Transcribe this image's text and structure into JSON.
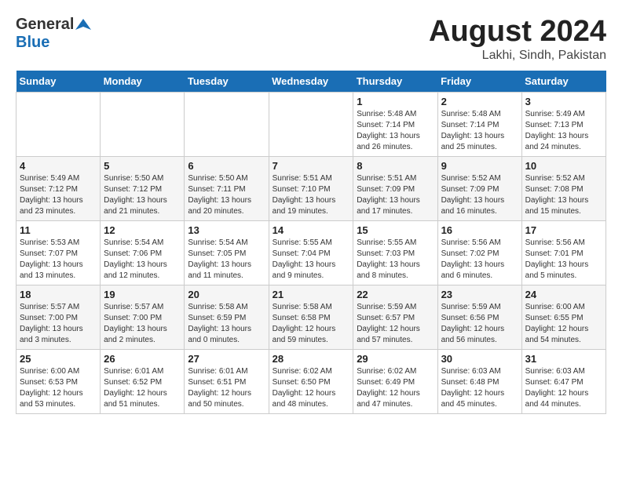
{
  "header": {
    "logo_general": "General",
    "logo_blue": "Blue",
    "title": "August 2024",
    "subtitle": "Lakhi, Sindh, Pakistan"
  },
  "weekdays": [
    "Sunday",
    "Monday",
    "Tuesday",
    "Wednesday",
    "Thursday",
    "Friday",
    "Saturday"
  ],
  "weeks": [
    [
      {
        "day": "",
        "info": ""
      },
      {
        "day": "",
        "info": ""
      },
      {
        "day": "",
        "info": ""
      },
      {
        "day": "",
        "info": ""
      },
      {
        "day": "1",
        "info": "Sunrise: 5:48 AM\nSunset: 7:14 PM\nDaylight: 13 hours\nand 26 minutes."
      },
      {
        "day": "2",
        "info": "Sunrise: 5:48 AM\nSunset: 7:14 PM\nDaylight: 13 hours\nand 25 minutes."
      },
      {
        "day": "3",
        "info": "Sunrise: 5:49 AM\nSunset: 7:13 PM\nDaylight: 13 hours\nand 24 minutes."
      }
    ],
    [
      {
        "day": "4",
        "info": "Sunrise: 5:49 AM\nSunset: 7:12 PM\nDaylight: 13 hours\nand 23 minutes."
      },
      {
        "day": "5",
        "info": "Sunrise: 5:50 AM\nSunset: 7:12 PM\nDaylight: 13 hours\nand 21 minutes."
      },
      {
        "day": "6",
        "info": "Sunrise: 5:50 AM\nSunset: 7:11 PM\nDaylight: 13 hours\nand 20 minutes."
      },
      {
        "day": "7",
        "info": "Sunrise: 5:51 AM\nSunset: 7:10 PM\nDaylight: 13 hours\nand 19 minutes."
      },
      {
        "day": "8",
        "info": "Sunrise: 5:51 AM\nSunset: 7:09 PM\nDaylight: 13 hours\nand 17 minutes."
      },
      {
        "day": "9",
        "info": "Sunrise: 5:52 AM\nSunset: 7:09 PM\nDaylight: 13 hours\nand 16 minutes."
      },
      {
        "day": "10",
        "info": "Sunrise: 5:52 AM\nSunset: 7:08 PM\nDaylight: 13 hours\nand 15 minutes."
      }
    ],
    [
      {
        "day": "11",
        "info": "Sunrise: 5:53 AM\nSunset: 7:07 PM\nDaylight: 13 hours\nand 13 minutes."
      },
      {
        "day": "12",
        "info": "Sunrise: 5:54 AM\nSunset: 7:06 PM\nDaylight: 13 hours\nand 12 minutes."
      },
      {
        "day": "13",
        "info": "Sunrise: 5:54 AM\nSunset: 7:05 PM\nDaylight: 13 hours\nand 11 minutes."
      },
      {
        "day": "14",
        "info": "Sunrise: 5:55 AM\nSunset: 7:04 PM\nDaylight: 13 hours\nand 9 minutes."
      },
      {
        "day": "15",
        "info": "Sunrise: 5:55 AM\nSunset: 7:03 PM\nDaylight: 13 hours\nand 8 minutes."
      },
      {
        "day": "16",
        "info": "Sunrise: 5:56 AM\nSunset: 7:02 PM\nDaylight: 13 hours\nand 6 minutes."
      },
      {
        "day": "17",
        "info": "Sunrise: 5:56 AM\nSunset: 7:01 PM\nDaylight: 13 hours\nand 5 minutes."
      }
    ],
    [
      {
        "day": "18",
        "info": "Sunrise: 5:57 AM\nSunset: 7:00 PM\nDaylight: 13 hours\nand 3 minutes."
      },
      {
        "day": "19",
        "info": "Sunrise: 5:57 AM\nSunset: 7:00 PM\nDaylight: 13 hours\nand 2 minutes."
      },
      {
        "day": "20",
        "info": "Sunrise: 5:58 AM\nSunset: 6:59 PM\nDaylight: 13 hours\nand 0 minutes."
      },
      {
        "day": "21",
        "info": "Sunrise: 5:58 AM\nSunset: 6:58 PM\nDaylight: 12 hours\nand 59 minutes."
      },
      {
        "day": "22",
        "info": "Sunrise: 5:59 AM\nSunset: 6:57 PM\nDaylight: 12 hours\nand 57 minutes."
      },
      {
        "day": "23",
        "info": "Sunrise: 5:59 AM\nSunset: 6:56 PM\nDaylight: 12 hours\nand 56 minutes."
      },
      {
        "day": "24",
        "info": "Sunrise: 6:00 AM\nSunset: 6:55 PM\nDaylight: 12 hours\nand 54 minutes."
      }
    ],
    [
      {
        "day": "25",
        "info": "Sunrise: 6:00 AM\nSunset: 6:53 PM\nDaylight: 12 hours\nand 53 minutes."
      },
      {
        "day": "26",
        "info": "Sunrise: 6:01 AM\nSunset: 6:52 PM\nDaylight: 12 hours\nand 51 minutes."
      },
      {
        "day": "27",
        "info": "Sunrise: 6:01 AM\nSunset: 6:51 PM\nDaylight: 12 hours\nand 50 minutes."
      },
      {
        "day": "28",
        "info": "Sunrise: 6:02 AM\nSunset: 6:50 PM\nDaylight: 12 hours\nand 48 minutes."
      },
      {
        "day": "29",
        "info": "Sunrise: 6:02 AM\nSunset: 6:49 PM\nDaylight: 12 hours\nand 47 minutes."
      },
      {
        "day": "30",
        "info": "Sunrise: 6:03 AM\nSunset: 6:48 PM\nDaylight: 12 hours\nand 45 minutes."
      },
      {
        "day": "31",
        "info": "Sunrise: 6:03 AM\nSunset: 6:47 PM\nDaylight: 12 hours\nand 44 minutes."
      }
    ]
  ]
}
